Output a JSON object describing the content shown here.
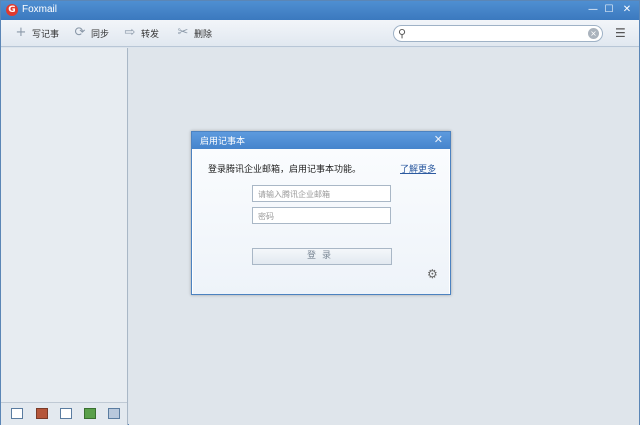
{
  "window": {
    "title": "Foxmail",
    "logo_letter": "G",
    "controls": {
      "minimize": "—",
      "maximize": "☐",
      "close": "✕"
    }
  },
  "toolbar": {
    "items": [
      {
        "label": "写记事",
        "icon": "+"
      },
      {
        "label": "同步",
        "icon": "⟳"
      },
      {
        "label": "转发",
        "icon": "⇨"
      },
      {
        "label": "删除",
        "icon": "✂"
      }
    ]
  },
  "search": {
    "placeholder": "",
    "clear": "×",
    "icon": "⚲"
  },
  "menu_icon": "☰",
  "dialog": {
    "title": "启用记事本",
    "close": "✕",
    "message": "登录腾讯企业邮箱，启用记事本功能。",
    "learn_more": "了解更多",
    "email_placeholder": "请输入腾讯企业邮箱",
    "password_placeholder": "密码",
    "login_label": "登录"
  },
  "settings_icon": "⚙",
  "colors": {
    "titlebar": "#4584cc",
    "accent": "#2c5aa0"
  }
}
